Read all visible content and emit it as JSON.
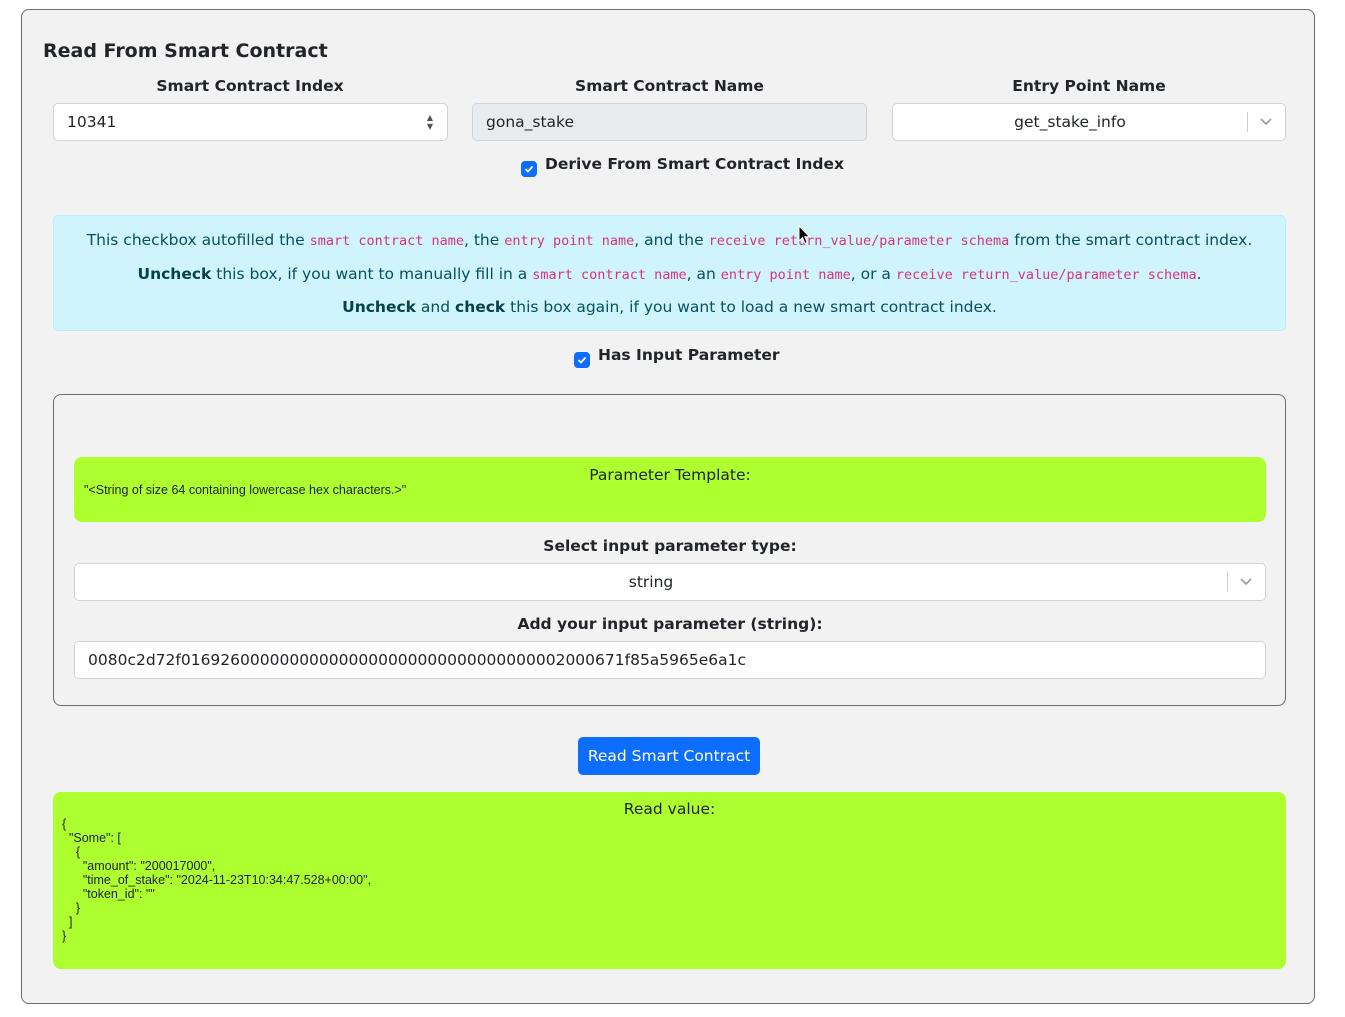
{
  "card": {
    "title": "Read From Smart Contract"
  },
  "fields": {
    "index_label": "Smart Contract Index",
    "index_value": "10341",
    "name_label": "Smart Contract Name",
    "name_value": "gona_stake",
    "entry_label": "Entry Point Name",
    "entry_value": "get_stake_info"
  },
  "derive_checkbox": {
    "label": "Derive From Smart Contract Index",
    "checked": true
  },
  "info": {
    "line1_a": "This checkbox autofilled the ",
    "line1_code1": "smart contract name",
    "line1_b": ", the ",
    "line1_code2": "entry point name",
    "line1_c": ", and the ",
    "line1_code3": "receive return_value/parameter schema",
    "line1_d": " from the smart contract index.",
    "line2_bold": "Uncheck",
    "line2_a": " this box, if you want to manually fill in a ",
    "line2_code1": "smart contract name",
    "line2_b": ", an ",
    "line2_code2": "entry point name",
    "line2_c": ", or a ",
    "line2_code3": "receive return_value/parameter schema",
    "line2_d": ".",
    "line3_bold1": "Uncheck",
    "line3_a": " and ",
    "line3_bold2": "check",
    "line3_b": " this box again, if you want to load a new smart contract index."
  },
  "input_param_checkbox": {
    "label": "Has Input Parameter",
    "checked": true
  },
  "param": {
    "template_title": "Parameter Template:",
    "template_value": "\"<String of size 64 containing lowercase hex characters.>\"",
    "type_label": "Select input parameter type:",
    "type_value": "string",
    "input_label": "Add your input parameter (string):",
    "input_value": "0080c2d72f016926000000000000000000000000000000002000671f85a5965e6a1c"
  },
  "read_button": {
    "label": "Read Smart Contract"
  },
  "result": {
    "title": "Read value:",
    "value": "{\n  \"Some\": [\n    {\n      \"amount\": \"200017000\",\n      \"time_of_stake\": \"2024-11-23T10:34:47.528+00:00\",\n      \"token_id\": \"\"\n    }\n  ]\n}"
  },
  "colors": {
    "accent": "#0d6efd",
    "lime": "#adff2f",
    "info_bg": "#cff4fc",
    "info_text": "#055160"
  }
}
